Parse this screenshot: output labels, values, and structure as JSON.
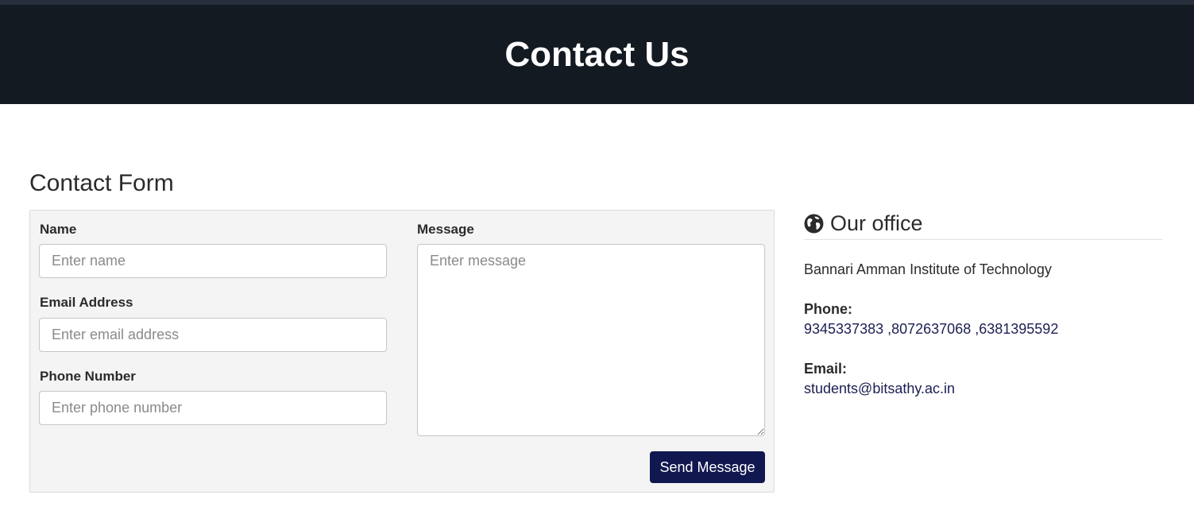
{
  "header": {
    "title": "Contact Us"
  },
  "form": {
    "title": "Contact Form",
    "name_label": "Name",
    "name_placeholder": "Enter name",
    "email_label": "Email Address",
    "email_placeholder": "Enter email address",
    "phone_label": "Phone Number",
    "phone_placeholder": "Enter phone number",
    "message_label": "Message",
    "message_placeholder": "Enter message",
    "submit_label": "Send Message"
  },
  "office": {
    "icon": "globe-icon",
    "title": "Our office",
    "organization": "Bannari Amman Institute of Technology",
    "phone_label": "Phone:",
    "phone_value": "9345337383 ,8072637068 ,6381395592",
    "email_label": "Email:",
    "email_value": "students@bitsathy.ac.in"
  },
  "colors": {
    "banner_bg": "#141a22",
    "button_bg": "#11174f",
    "panel_bg": "#f4f4f4",
    "link_text": "#1b1f52"
  }
}
